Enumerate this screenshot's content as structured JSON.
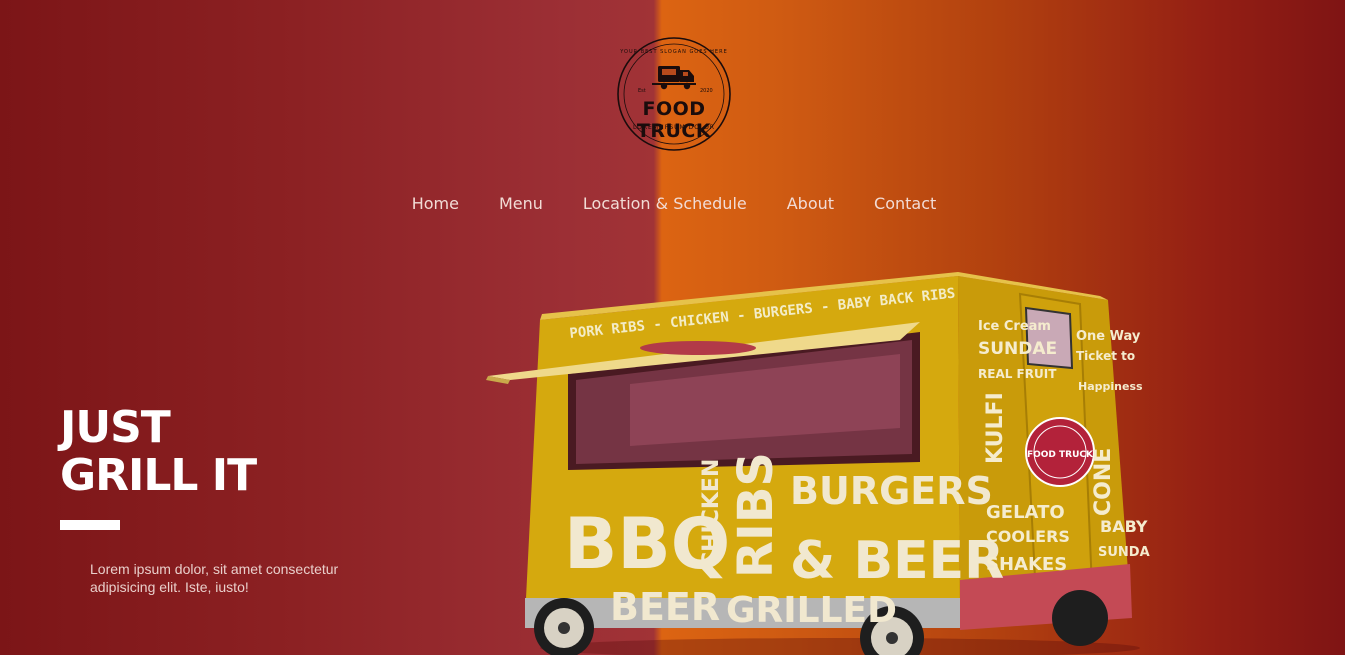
{
  "logo": {
    "brand": "FOOD TRUCK",
    "sub": "LOREM IPSUM DOLOR",
    "slogan": "YOUR BEST SLOGAN GOES HERE",
    "year_left": "Est",
    "year_right": "2020"
  },
  "nav": {
    "items": [
      {
        "label": "Home"
      },
      {
        "label": "Menu"
      },
      {
        "label": "Location & Schedule"
      },
      {
        "label": "About"
      },
      {
        "label": "Contact"
      }
    ]
  },
  "hero": {
    "title_line1": "JUST",
    "title_line2": "GRILL IT",
    "body": "Lorem ipsum dolor, sit amet consectetur adipisicing elit. Iste, iusto!"
  },
  "truck": {
    "top_banner": "PORK RIBS  -  CHICKEN  -  BURGERS  -  BABY BACK RIBS",
    "side_bbq": "BBQ",
    "side_chicken": "CHICKEN",
    "side_ribs": "RIBS",
    "side_burgers": "BURGERS",
    "side_beer_big": "& BEER",
    "side_beer": "BEER",
    "side_grilled": "GRILLED",
    "back_words": [
      "Ice Cream",
      "SUNDAE",
      "REAL FRUIT",
      "KULFI",
      "GELATO",
      "COOLERS",
      "SHAKES"
    ],
    "door_words": [
      "One Way",
      "Ticket to",
      "Happiness",
      "CONE",
      "BABY",
      "SUNDAE"
    ],
    "badge": "FOOD TRUCK"
  },
  "colors": {
    "bg_left": "#8c2123",
    "bg_right": "#dc6412",
    "truck_yellow": "#d5a90e",
    "white": "#ffffff"
  }
}
